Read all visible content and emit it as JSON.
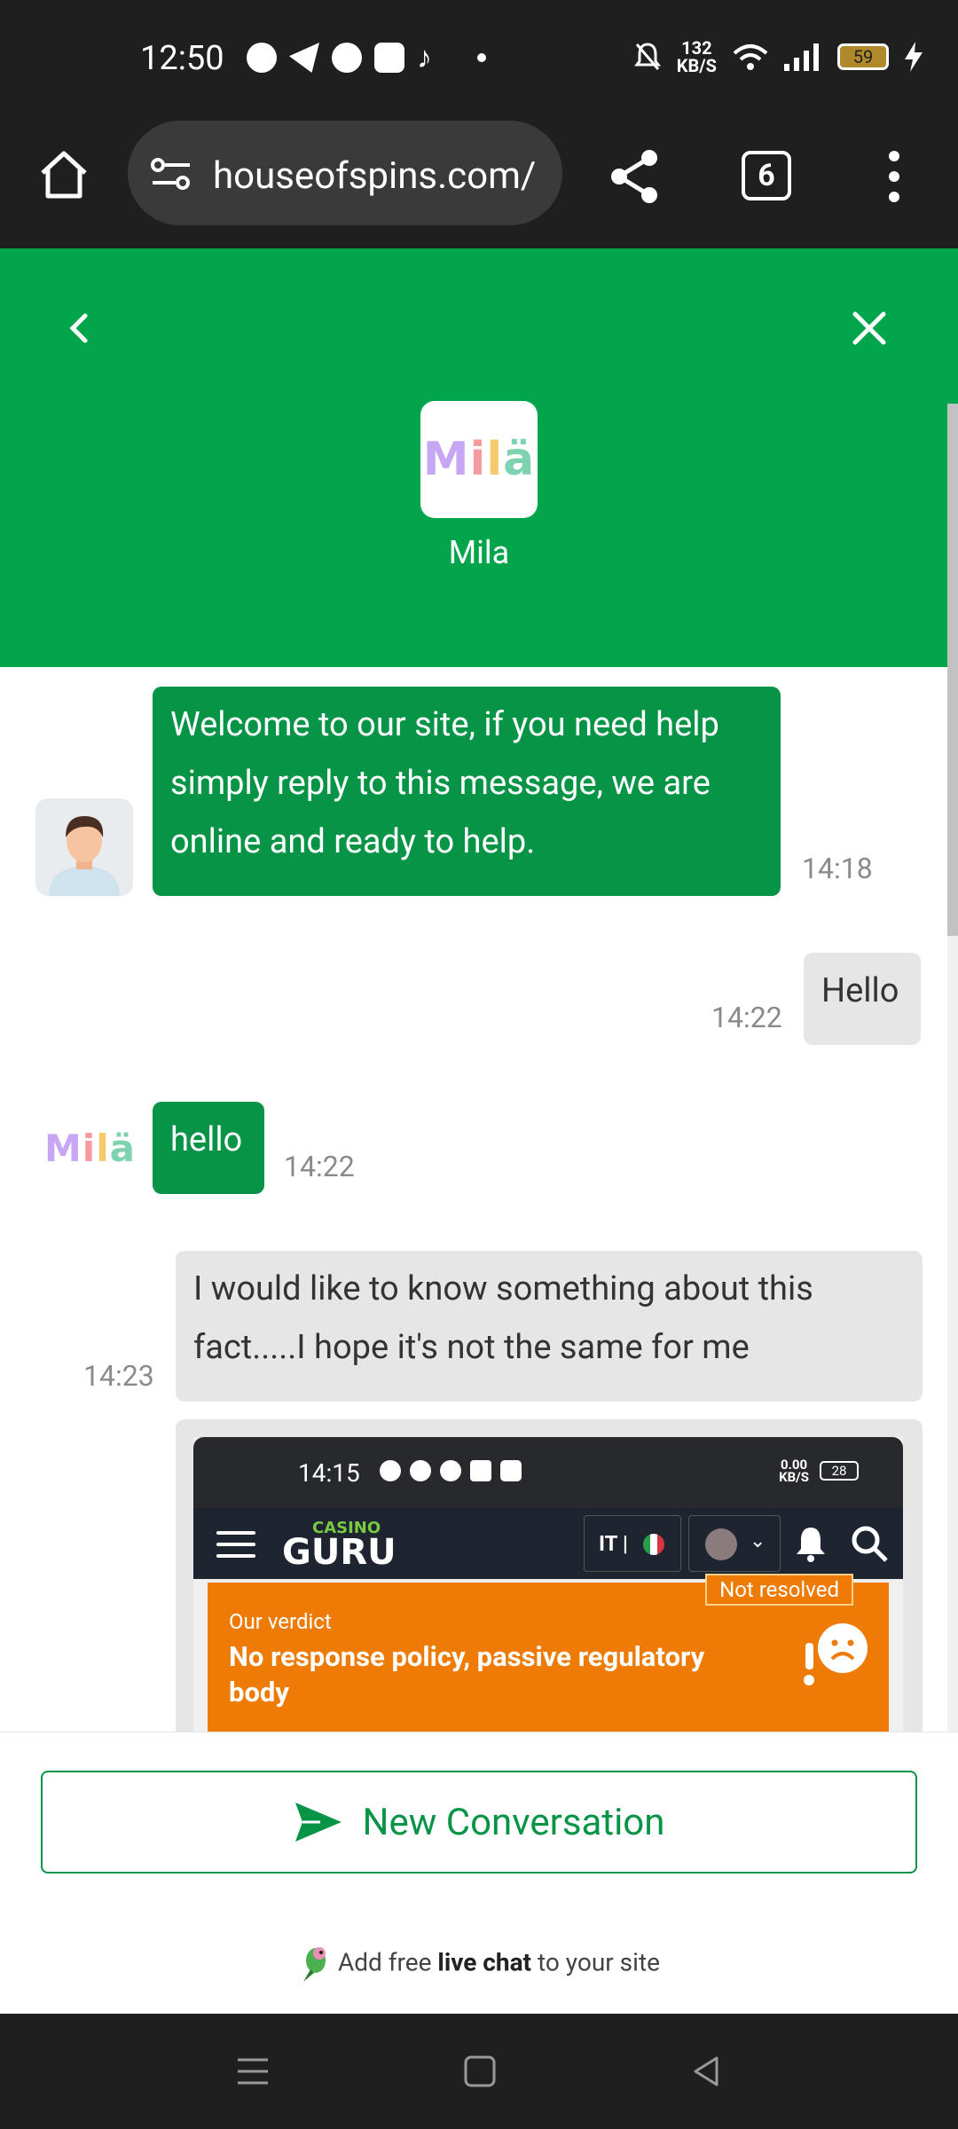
{
  "status_bar": {
    "time": "12:50",
    "net_speed_value": "132",
    "net_speed_unit": "KB/S",
    "battery": "59"
  },
  "browser": {
    "url": "houseofspins.com/",
    "tab_count": "6"
  },
  "chat": {
    "agent_name": "Mila",
    "logo_text": {
      "m": "M",
      "i": "i",
      "l": "l",
      "a": "ä"
    },
    "messages": [
      {
        "from": "agent",
        "text": "Welcome to our site, if you need help simply reply to this message, we are online and ready to help.",
        "time": "14:18"
      },
      {
        "from": "user",
        "text": "Hello",
        "time": "14:22"
      },
      {
        "from": "agent",
        "text": "hello",
        "time": "14:22"
      },
      {
        "from": "user",
        "text": "I would like to know something about this fact.....I hope it's not the same for me",
        "time": "14:23"
      }
    ],
    "attachment": {
      "status_time": "14:15",
      "speed_value": "0.00",
      "speed_unit": "KB/S",
      "battery": "28",
      "logo_small": "CASINO",
      "logo_big": "GURU",
      "lang": "IT |",
      "badge": "Not resolved",
      "verdict_label": "Our verdict",
      "verdict_title": "No response policy, passive regulatory body"
    },
    "new_conversation_label": "New Conversation",
    "powered_prefix": "Add free",
    "powered_bold": "live chat",
    "powered_suffix": "to your site"
  },
  "colors": {
    "brand_green": "#02a54c",
    "bubble_green": "#079447",
    "verdict_orange": "#ee7b05"
  }
}
